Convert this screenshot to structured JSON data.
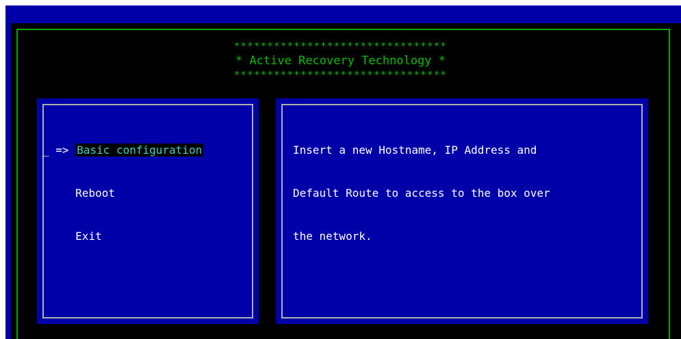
{
  "header": {
    "stars_top": "********************************",
    "title": "* Active Recovery Technology *",
    "stars_bottom": "********************************"
  },
  "menu": {
    "cursor": "_",
    "arrow": "=>",
    "items": [
      {
        "label": "Basic configuration",
        "selected": true
      },
      {
        "label": "Reboot",
        "selected": false
      },
      {
        "label": "Exit",
        "selected": false
      }
    ]
  },
  "description": {
    "lines": [
      "Insert a new Hostname, IP Address and",
      "Default Route to access to the box over",
      "the network."
    ]
  },
  "colors": {
    "background_blue": "#0000a8",
    "frame_green": "#00a800",
    "selected_text": "#3fd0c0",
    "panel_border": "#b0b0b0"
  }
}
